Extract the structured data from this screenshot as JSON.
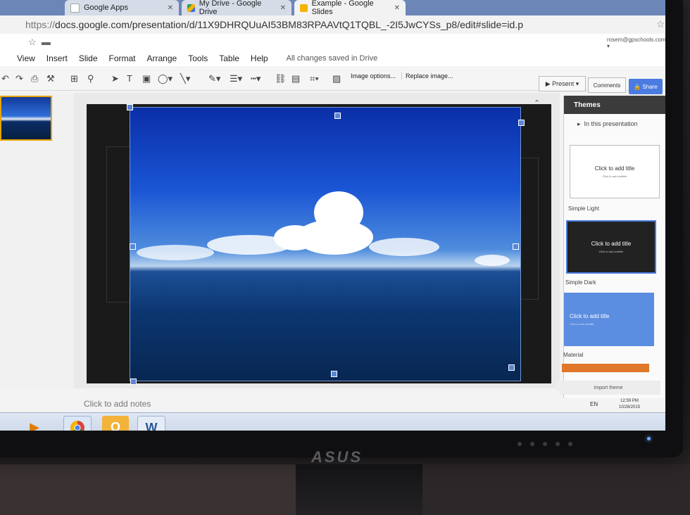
{
  "browser": {
    "tabs": [
      {
        "label": "Google Apps",
        "icon": "doc-icon"
      },
      {
        "label": "My Drive - Google Drive",
        "icon": "drive-icon"
      },
      {
        "label": "Example - Google Slides",
        "icon": "slides-icon",
        "active": true
      }
    ],
    "url_prefix": "https://",
    "url": "docs.google.com/presentation/d/11X9DHRQUuAI53BM83RPAAVtQ1TQBL_-2I5JwCYSs_p8/edit#slide=id.p"
  },
  "doc": {
    "user": "rosem@gpschools.com ▾"
  },
  "menu": {
    "items": [
      "View",
      "Insert",
      "Slide",
      "Format",
      "Arrange",
      "Tools",
      "Table",
      "Help"
    ],
    "status": "All changes saved in Drive"
  },
  "toolbar": {
    "image_options": "Image options...",
    "replace_image": "Replace image...",
    "present": "Present",
    "comments": "Comments",
    "share": "Share"
  },
  "themes": {
    "title": "Themes",
    "section": "In this presentation",
    "cards": [
      {
        "name": "Simple Light",
        "title": "Click to add title",
        "subtitle": "Click to add subtitle",
        "bg": "#ffffff",
        "fg": "#333333"
      },
      {
        "name": "Simple Dark",
        "title": "Click to add title",
        "subtitle": "Click to add subtitle",
        "bg": "#222222",
        "fg": "#ffffff"
      },
      {
        "name": "Material",
        "title": "Click to add title",
        "subtitle": "Click to add subtitle",
        "bg": "#5b8de0",
        "fg": "#ffffff"
      }
    ],
    "import": "Import theme"
  },
  "notes": {
    "placeholder": "Click to add notes"
  },
  "taskbar": {
    "lang": "EN",
    "time": "12:59 PM",
    "date": "10/28/2015"
  },
  "monitor": {
    "brand": "ASUS"
  },
  "colors": {
    "accent": "#4a7be0",
    "selection": "#5b86d6",
    "active_thumb_border": "#e8a400"
  }
}
